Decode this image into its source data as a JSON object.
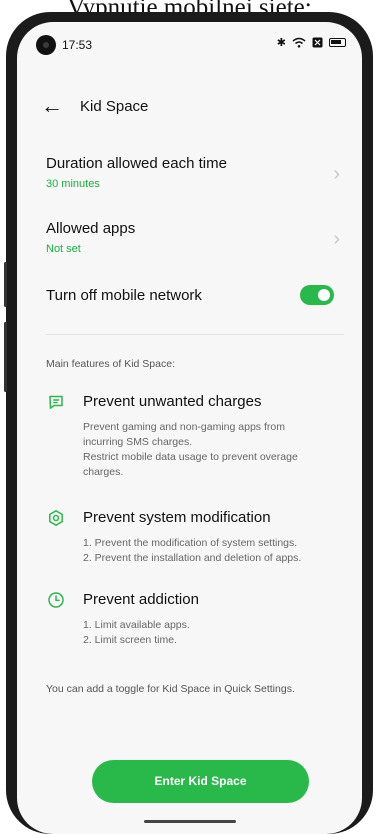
{
  "caption": "Vypnutie mobilnej siete:",
  "status_bar": {
    "time": "17:53"
  },
  "header": {
    "title": "Kid Space"
  },
  "settings": {
    "duration": {
      "label": "Duration allowed each time",
      "value": "30 minutes"
    },
    "apps": {
      "label": "Allowed apps",
      "value": "Not set"
    },
    "network": {
      "label": "Turn off mobile network",
      "enabled": true
    }
  },
  "features": {
    "heading": "Main features of Kid Space:",
    "items": [
      {
        "title": "Prevent unwanted charges",
        "icon": "message-icon",
        "lines": [
          "Prevent gaming and non-gaming apps from",
          "incurring SMS charges.",
          "Restrict mobile data usage to prevent overage",
          "charges."
        ]
      },
      {
        "title": "Prevent system modification",
        "icon": "hexagon-settings-icon",
        "lines": [
          "1. Prevent the modification of system settings.",
          "2. Prevent the installation and deletion of apps."
        ]
      },
      {
        "title": "Prevent addiction",
        "icon": "clock-icon",
        "lines": [
          "1. Limit available apps.",
          "2. Limit screen time."
        ]
      }
    ]
  },
  "note": "You can add a toggle for Kid Space in Quick Settings.",
  "cta_label": "Enter Kid Space",
  "colors": {
    "accent": "#29b94b",
    "accent_text": "#18b33b"
  }
}
